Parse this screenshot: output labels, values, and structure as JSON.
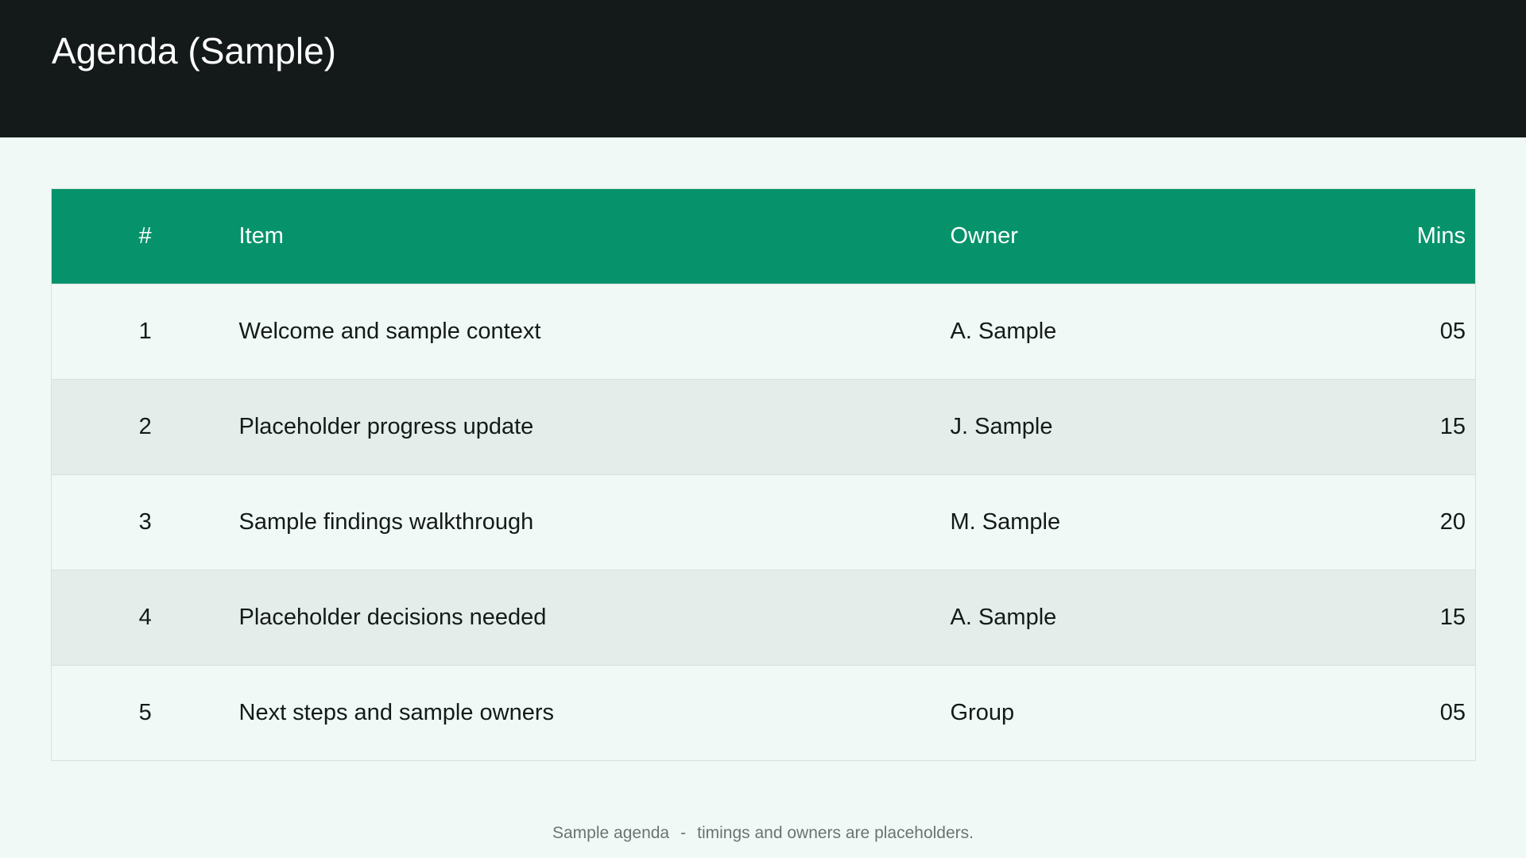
{
  "slide": {
    "title": "Agenda (Sample)"
  },
  "table": {
    "columns": {
      "number": "#",
      "item": "Item",
      "owner": "Owner",
      "mins": "Mins"
    },
    "rows": [
      {
        "number": "1",
        "item": "Welcome and sample context",
        "owner": "A. Sample",
        "mins": "05"
      },
      {
        "number": "2",
        "item": "Placeholder progress update",
        "owner": "J. Sample",
        "mins": "15"
      },
      {
        "number": "3",
        "item": "Sample findings walkthrough",
        "owner": "M. Sample",
        "mins": "20"
      },
      {
        "number": "4",
        "item": "Placeholder decisions needed",
        "owner": "A. Sample",
        "mins": "15"
      },
      {
        "number": "5",
        "item": "Next steps and sample owners",
        "owner": "Group",
        "mins": "05"
      }
    ]
  },
  "footer": {
    "left": "Sample agenda",
    "separator": "-",
    "right": "timings and owners are placeholders."
  },
  "colors": {
    "header_background": "#141a19",
    "table_header": "#06936b",
    "page_background": "#f0f9f5",
    "row_alt": "#e4ede9"
  }
}
